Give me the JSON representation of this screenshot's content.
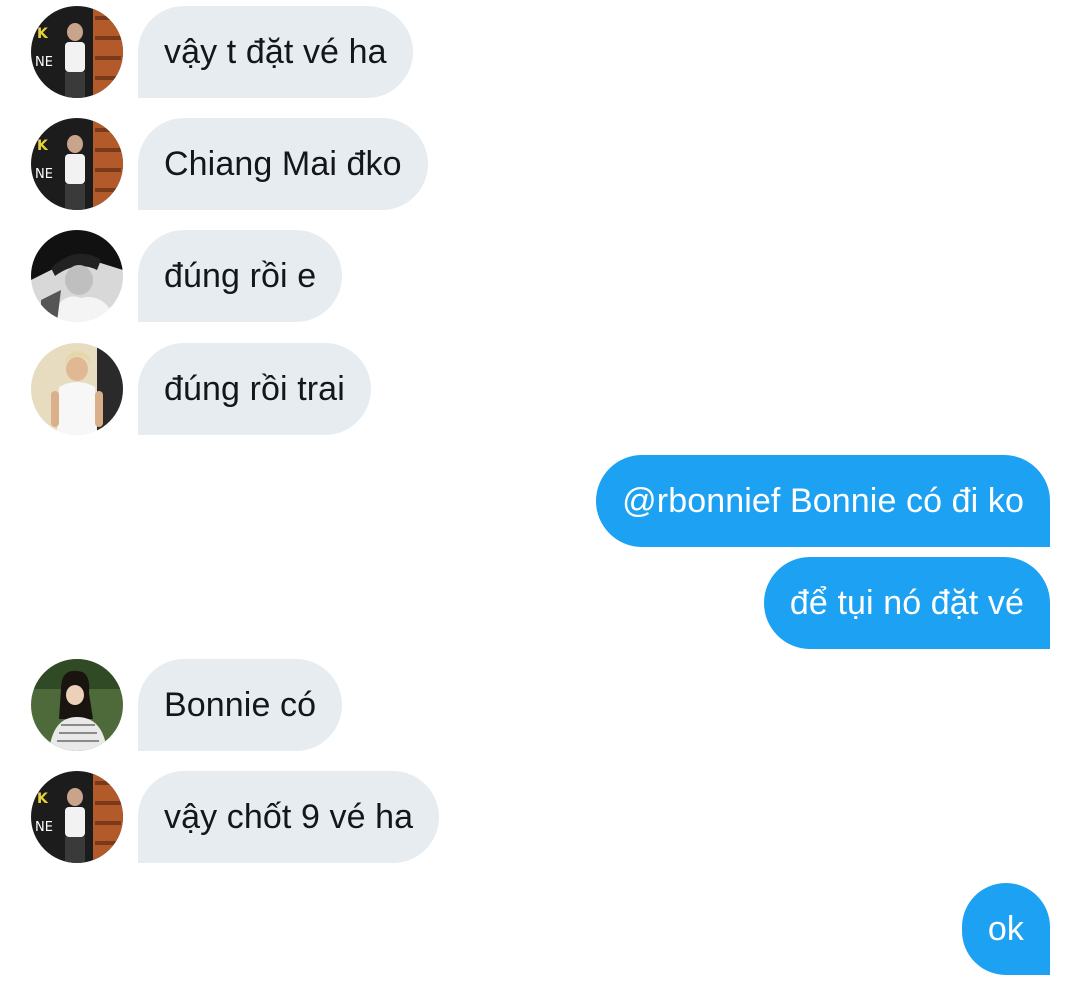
{
  "colors": {
    "incoming_bubble": "#e6ecf0",
    "outgoing_bubble": "#1da1f2",
    "incoming_text": "#14171a",
    "outgoing_text": "#ffffff"
  },
  "messages": [
    {
      "direction": "incoming",
      "avatar": "avatar-user-tank",
      "text": "vậy t đặt vé ha"
    },
    {
      "direction": "incoming",
      "avatar": "avatar-user-tank",
      "text": "Chiang Mai đko"
    },
    {
      "direction": "incoming",
      "avatar": "avatar-user-bw-cap",
      "text": "đúng rồi e"
    },
    {
      "direction": "incoming",
      "avatar": "avatar-user-blond",
      "text": "đúng rồi trai"
    },
    {
      "direction": "outgoing",
      "text": "@rbonnief Bonnie có đi ko"
    },
    {
      "direction": "outgoing",
      "text": "để tụi nó đặt vé"
    },
    {
      "direction": "incoming",
      "avatar": "avatar-user-bonnie",
      "text": "Bonnie có"
    },
    {
      "direction": "incoming",
      "avatar": "avatar-user-tank",
      "text": "vậy chốt 9 vé ha"
    },
    {
      "direction": "outgoing",
      "text": "ok"
    }
  ]
}
